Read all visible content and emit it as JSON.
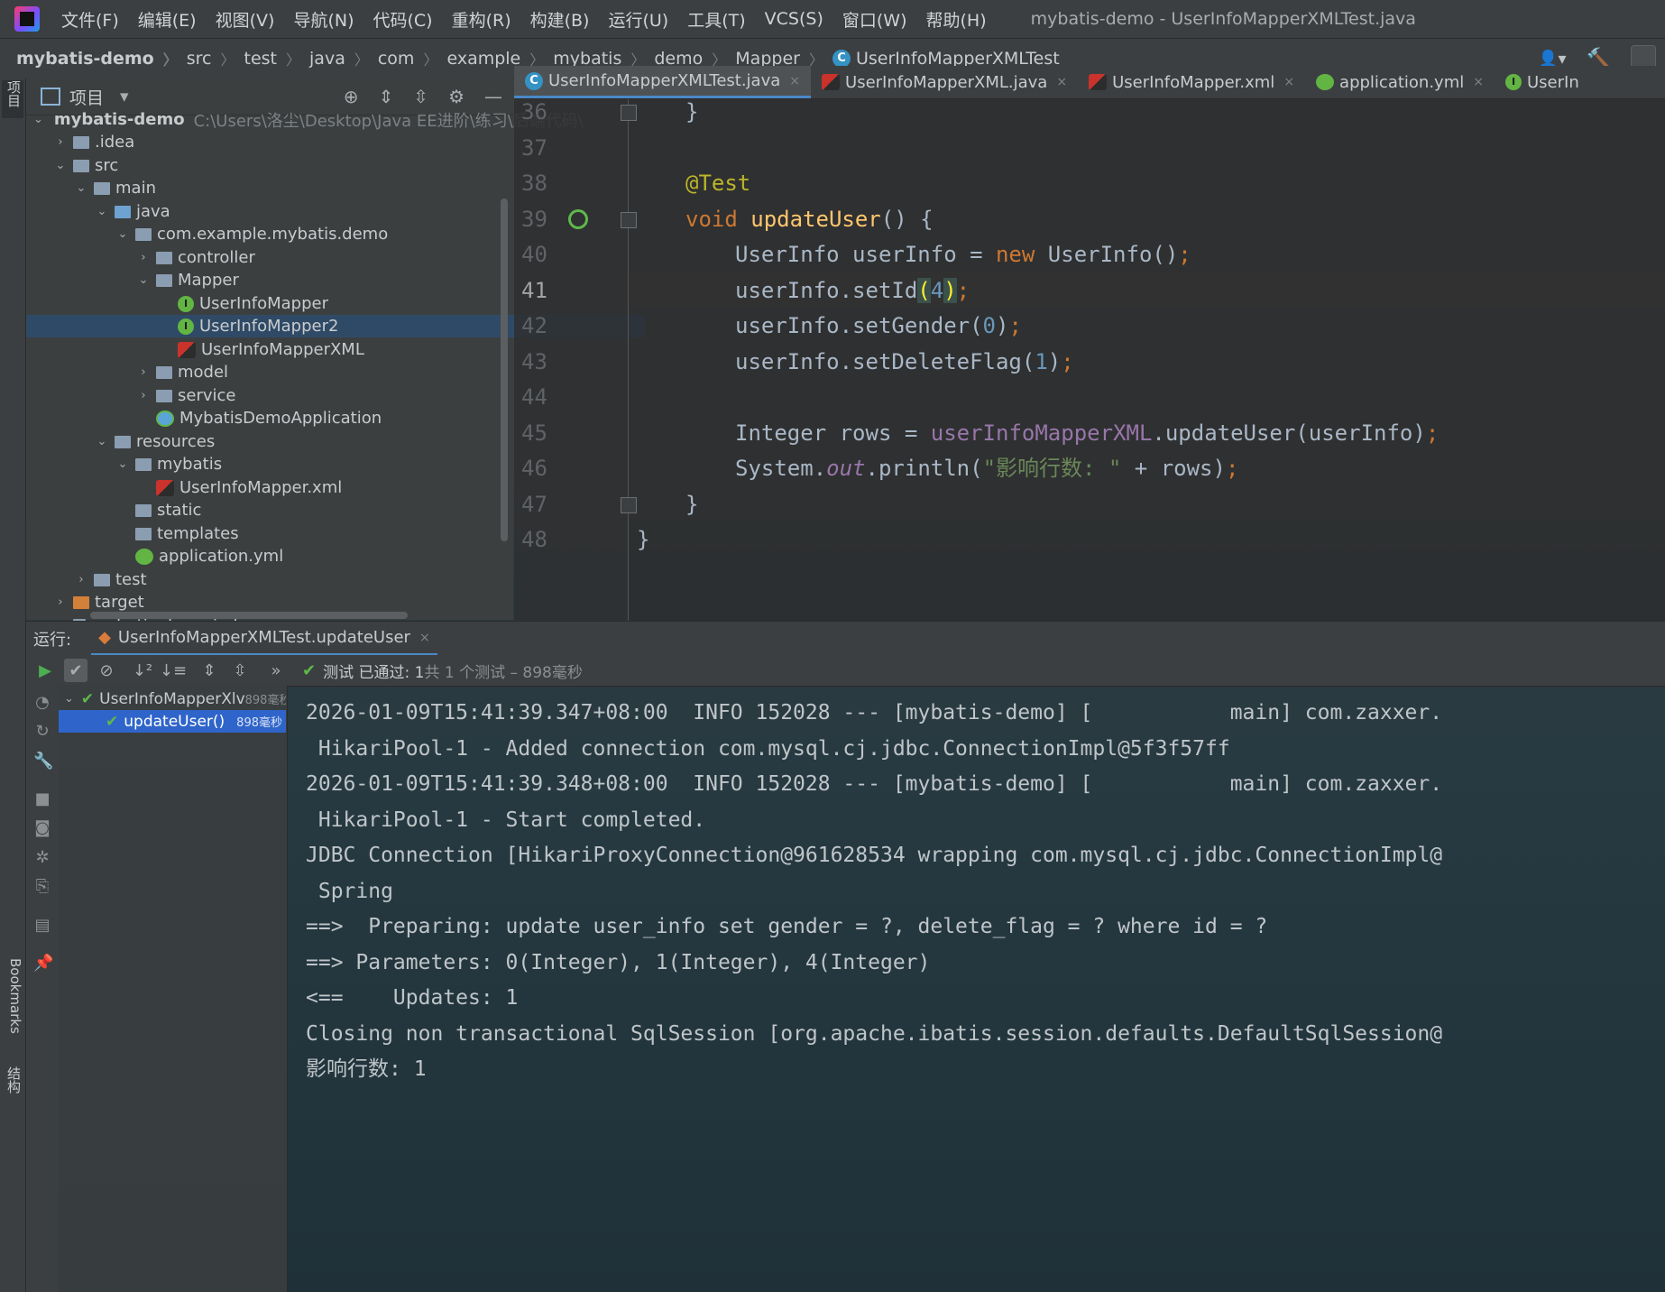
{
  "menubar": {
    "items": [
      "文件(F)",
      "编辑(E)",
      "视图(V)",
      "导航(N)",
      "代码(C)",
      "重构(R)",
      "构建(B)",
      "运行(U)",
      "工具(T)",
      "VCS(S)",
      "窗口(W)",
      "帮助(H)"
    ],
    "window_title": "mybatis-demo - UserInfoMapperXMLTest.java"
  },
  "breadcrumb": [
    "mybatis-demo",
    "src",
    "test",
    "java",
    "com",
    "example",
    "mybatis",
    "demo",
    "Mapper",
    "UserInfoMapperXMLTest"
  ],
  "left_strip": {
    "project_label": "项目",
    "bookmarks_label": "Bookmarks",
    "structure_label": "结构"
  },
  "project_panel": {
    "title": "项目",
    "root": {
      "name": "mybatis-demo",
      "path": "C:\\Users\\洛尘\\Desktop\\Java EE进阶\\练习\\后端代码\\"
    },
    "tree": [
      {
        "label": ".idea",
        "arrow": "›"
      },
      {
        "label": "src",
        "arrow": "⌄"
      },
      {
        "label": "main",
        "arrow": "⌄"
      },
      {
        "label": "java",
        "arrow": "⌄"
      },
      {
        "label": "com.example.mybatis.demo",
        "arrow": "⌄"
      },
      {
        "label": "controller",
        "arrow": "›"
      },
      {
        "label": "Mapper",
        "arrow": "⌄"
      },
      {
        "label": "UserInfoMapper",
        "arrow": ""
      },
      {
        "label": "UserInfoMapper2",
        "arrow": ""
      },
      {
        "label": "UserInfoMapperXML",
        "arrow": ""
      },
      {
        "label": "model",
        "arrow": "›"
      },
      {
        "label": "service",
        "arrow": "›"
      },
      {
        "label": "MybatisDemoApplication",
        "arrow": ""
      },
      {
        "label": "resources",
        "arrow": "⌄"
      },
      {
        "label": "mybatis",
        "arrow": "⌄"
      },
      {
        "label": "UserInfoMapper.xml",
        "arrow": ""
      },
      {
        "label": "static",
        "arrow": ""
      },
      {
        "label": "templates",
        "arrow": ""
      },
      {
        "label": "application.yml",
        "arrow": ""
      },
      {
        "label": "test",
        "arrow": "›"
      },
      {
        "label": "target",
        "arrow": "›"
      },
      {
        "label": "mybatis-demo.iml",
        "arrow": ""
      }
    ],
    "selected": "UserInfoMapper2"
  },
  "editor": {
    "tabs": [
      {
        "label": "UserInfoMapperXMLTest.java",
        "active": true
      },
      {
        "label": "UserInfoMapperXML.java",
        "active": false
      },
      {
        "label": "UserInfoMapper.xml",
        "active": false
      },
      {
        "label": "application.yml",
        "active": false
      },
      {
        "label": "UserIn",
        "active": false
      }
    ],
    "line_numbers": [
      "36",
      "37",
      "38",
      "39",
      "40",
      "41",
      "42",
      "43",
      "44",
      "45",
      "46",
      "47",
      "48"
    ],
    "current_line": "41",
    "code": {
      "l36_brace": "}",
      "l38_annotation": "@Test",
      "l39_void": "void",
      "l39_name": "updateUser",
      "l39_rest": "() {",
      "l40_type": "UserInfo userInfo = ",
      "l40_new": "new",
      "l40_rest": " UserInfo()",
      "l40_semi": ";",
      "l41_a": "userInfo.setId",
      "l41_po": "(",
      "l41_num": "4",
      "l41_pc": ")",
      "l41_semi": ";",
      "l42_a": "userInfo.setGender(",
      "l42_num": "0",
      "l42_b": ")",
      "l42_semi": ";",
      "l43_a": "userInfo.setDeleteFlag(",
      "l43_num": "1",
      "l43_b": ")",
      "l43_semi": ";",
      "l45_a": "Integer rows = ",
      "l45_field": "userInfoMapperXML",
      "l45_b": ".updateUser(userInfo)",
      "l45_semi": ";",
      "l46_a": "System.",
      "l46_out": "out",
      "l46_b": ".println(",
      "l46_str": "\"影响行数: \"",
      "l46_c": " + rows)",
      "l46_semi": ";",
      "l47_brace": "}",
      "l48_brace": "}"
    }
  },
  "run_panel": {
    "label": "运行:",
    "tab": "UserInfoMapperXMLTest.updateUser",
    "status_main": "测试 已通过: 1",
    "status_dim": "共 1 个测试 – 898毫秒",
    "tests": [
      {
        "label": "UserInfoMapperXlv",
        "time": "898毫秒"
      },
      {
        "label": "updateUser()",
        "time": "898毫秒"
      }
    ],
    "console": [
      "2026-01-09T15:41:39.347+08:00  INFO 152028 --- [mybatis-demo] [           main] com.zaxxer.",
      " HikariPool-1 - Added connection com.mysql.cj.jdbc.ConnectionImpl@5f3f57ff",
      "2026-01-09T15:41:39.348+08:00  INFO 152028 --- [mybatis-demo] [           main] com.zaxxer.",
      " HikariPool-1 - Start completed.",
      "JDBC Connection [HikariProxyConnection@961628534 wrapping com.mysql.cj.jdbc.ConnectionImpl@",
      " Spring",
      "==>  Preparing: update user_info set gender = ?, delete_flag = ? where id = ?",
      "==> Parameters: 0(Integer), 1(Integer), 4(Integer)",
      "<==    Updates: 1",
      "Closing non transactional SqlSession [org.apache.ibatis.session.defaults.DefaultSqlSession@",
      "影响行数: 1"
    ]
  }
}
